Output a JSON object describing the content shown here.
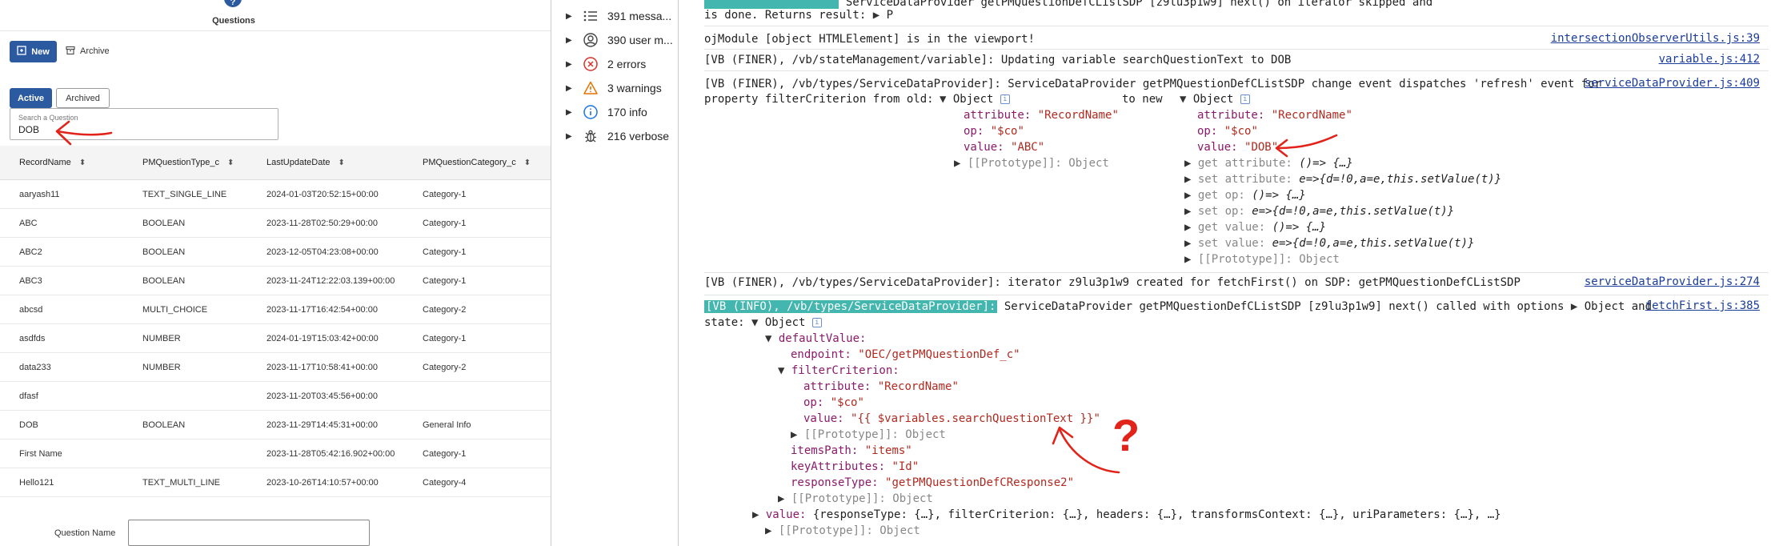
{
  "app": {
    "title": "Questions",
    "new_label": "New",
    "archive_label": "Archive",
    "tab_active": "Active",
    "tab_archived": "Archived",
    "search_label": "Search a Question",
    "search_value": "DOB",
    "question_name_label": "Question Name",
    "columns": [
      "RecordName",
      "PMQuestionType_c",
      "LastUpdateDate",
      "PMQuestionCategory_c"
    ],
    "rows": [
      [
        "aaryash11",
        "TEXT_SINGLE_LINE",
        "2024-01-03T20:52:15+00:00",
        "Category-1"
      ],
      [
        "ABC",
        "BOOLEAN",
        "2023-11-28T02:50:29+00:00",
        "Category-1"
      ],
      [
        "ABC2",
        "BOOLEAN",
        "2023-12-05T04:23:08+00:00",
        "Category-1"
      ],
      [
        "ABC3",
        "BOOLEAN",
        "2023-11-24T12:22:03.139+00:00",
        "Category-1"
      ],
      [
        "abcsd",
        "MULTI_CHOICE",
        "2023-11-17T16:42:54+00:00",
        "Category-2"
      ],
      [
        "asdfds",
        "NUMBER",
        "2024-01-19T15:03:42+00:00",
        "Category-1"
      ],
      [
        "data233",
        "NUMBER",
        "2023-11-17T10:58:41+00:00",
        "Category-2"
      ],
      [
        "dfasf",
        "",
        "2023-11-20T03:45:56+00:00",
        ""
      ],
      [
        "DOB",
        "BOOLEAN",
        "2023-11-29T14:45:31+00:00",
        "General Info"
      ],
      [
        "First Name",
        "",
        "2023-11-28T05:42:16.902+00:00",
        "Category-1"
      ],
      [
        "Hello121",
        "TEXT_MULTI_LINE",
        "2023-10-26T14:10:57+00:00",
        "Category-4"
      ]
    ]
  },
  "sidebar": {
    "items": [
      {
        "label": "391 messa...",
        "icon": "list-icon"
      },
      {
        "label": "390 user m...",
        "icon": "user-icon"
      },
      {
        "label": "2 errors",
        "icon": "error-icon"
      },
      {
        "label": "3 warnings",
        "icon": "warning-icon"
      },
      {
        "label": "170 info",
        "icon": "info-icon"
      },
      {
        "label": "216 verbose",
        "icon": "bug-icon"
      }
    ]
  },
  "console": {
    "l1_text": "ServiceDataProvider getPMQuestionDefCListSDP [z9lu3p1w9] next() on iterator skipped and",
    "l2_text": "is done. Returns result: ",
    "l2_p": "P",
    "l3_text": "ojModule [object HTMLElement] is in the viewport!",
    "l3_src": "intersectionObserverUtils.js:39",
    "l4_tag": "[VB (FINER), /vb/stateManagement/variable]:",
    "l4_text": " Updating variable searchQuestionText to DOB",
    "l4_src": "variable.js:412",
    "l5_tag": "[VB (FINER), /vb/types/ServiceDataProvider]:",
    "l5_text": " ServiceDataProvider getPMQuestionDefCListSDP change event dispatches 'refresh' event for",
    "l5_src": "serviceDataProvider.js:409",
    "l6_a": "property filterCriterion from old: ",
    "l6_obj1": "Object",
    "l6_mid": "to new ",
    "l6_obj2": "Object",
    "old_attr_k": "attribute:",
    "old_attr_v": "\"RecordName\"",
    "old_op_k": "op:",
    "old_op_v": "\"$co\"",
    "old_val_k": "value:",
    "old_val_v": "\"ABC\"",
    "old_proto": "[[Prototype]]: Object",
    "new_attr_v": "\"RecordName\"",
    "new_op_v": "\"$co\"",
    "new_val_v": "\"DOB\"",
    "get_attr": "get attribute: ",
    "get_fn": "()=> {…}",
    "set_attr": "set attribute: ",
    "set_fn": "e=>{d=!0,a=e,this.setValue(t)}",
    "get_op": "get op: ",
    "set_op": "set op: ",
    "get_value": "get value: ",
    "set_value": "set value: ",
    "l7_tag": "[VB (FINER), /vb/types/ServiceDataProvider]:",
    "l7_text": " iterator z9lu3p1w9 created for fetchFirst() on SDP: getPMQuestionDefCListSDP",
    "l7_src": "serviceDataProvider.js:274",
    "l8_tag": "[VB (INFO), /vb/types/ServiceDataProvider]:",
    "l8_text": " ServiceDataProvider getPMQuestionDefCListSDP [z9lu3p1w9] next() called with options ",
    "l8_obj": "Object",
    "l8_and": " and",
    "l8_src": "fetchFirst.js:385",
    "l9_state": "state: ",
    "l9_obj": "Object",
    "dv_k": "defaultValue:",
    "ep_k": "endpoint:",
    "ep_v": "\"OEC/getPMQuestionDef_c\"",
    "fc_k": "filterCriterion:",
    "fc_attr_v": "\"RecordName\"",
    "fc_op_v": "\"$co\"",
    "fc_val_v": "\"{{ $variables.searchQuestionText }}\"",
    "ip_k": "itemsPath:",
    "ip_v": "\"items\"",
    "ka_k": "keyAttributes:",
    "ka_v": "\"Id\"",
    "rt_k": "responseType:",
    "rt_v": "\"getPMQuestionDefCResponse2\"",
    "value_k": "value:",
    "value_rest": " {responseType: {…}, filterCriterion: {…}, headers: {…}, transformsContext: {…}, uriParameters: {…}, …}",
    "proto_last": "[[Prototype]]: Object",
    "info_badge": "i"
  },
  "annotation": {
    "mark": "?"
  },
  "colors": {
    "primary": "#2c5aa0",
    "annotation": "#e2231a",
    "tag": "#43b6b0"
  }
}
